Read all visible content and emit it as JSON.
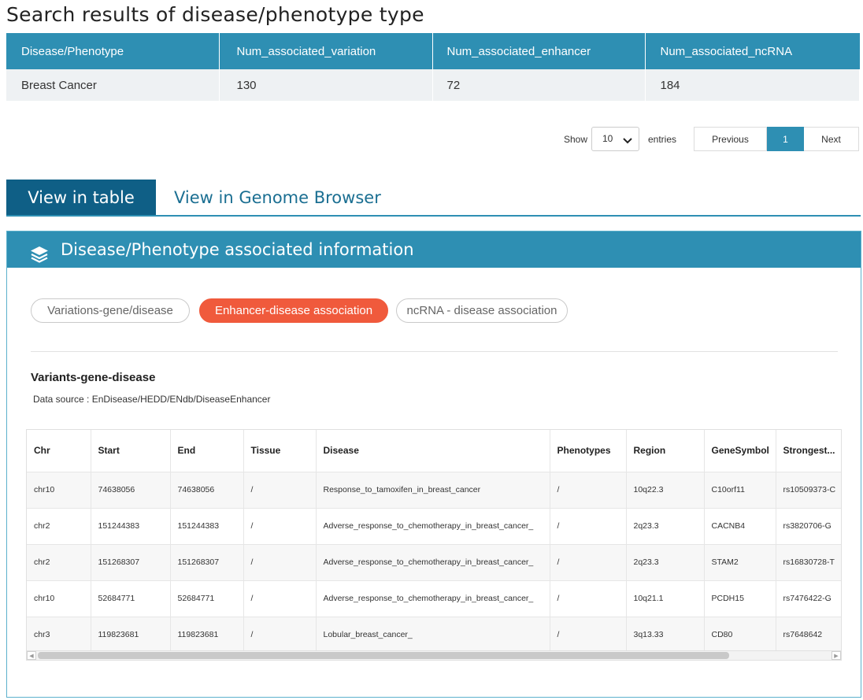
{
  "page": {
    "title": "Search results of disease/phenotype type"
  },
  "summary": {
    "headers": [
      "Disease/Phenotype",
      "Num_associated_variation",
      "Num_associated_enhancer",
      "Num_associated_ncRNA"
    ],
    "row": [
      "Breast Cancer",
      "130",
      "72",
      "184"
    ]
  },
  "paging": {
    "show_label": "Show",
    "entries_value": "10",
    "entries_label": "entries",
    "previous": "Previous",
    "current_page": "1",
    "next": "Next"
  },
  "view_tabs": {
    "table": "View in table",
    "genome": "View in Genome Browser"
  },
  "panel": {
    "title": "Disease/Phenotype associated information",
    "pills": [
      "Variations-gene/disease",
      "Enhancer-disease association",
      "ncRNA - disease association"
    ],
    "active_pill": "Enhancer-disease association",
    "section_title": "Variants-gene-disease",
    "data_source": "Data source : EnDisease/HEDD/ENdb/DiseaseEnhancer"
  },
  "grid": {
    "headers": [
      "Chr",
      "Start",
      "End",
      "Tissue",
      "Disease",
      "Phenotypes",
      "Region",
      "GeneSymbol",
      "Strongest..."
    ],
    "rows": [
      [
        "chr10",
        "74638056",
        "74638056",
        "/",
        "Response_to_tamoxifen_in_breast_cancer",
        "/",
        "10q22.3",
        "C10orf11",
        "rs10509373-C"
      ],
      [
        "chr2",
        "151244383",
        "151244383",
        "/",
        "Adverse_response_to_chemotherapy_in_breast_cancer_",
        "/",
        "2q23.3",
        "CACNB4",
        "rs3820706-G"
      ],
      [
        "chr2",
        "151268307",
        "151268307",
        "/",
        "Adverse_response_to_chemotherapy_in_breast_cancer_",
        "/",
        "2q23.3",
        "STAM2",
        "rs16830728-T"
      ],
      [
        "chr10",
        "52684771",
        "52684771",
        "/",
        "Adverse_response_to_chemotherapy_in_breast_cancer_",
        "/",
        "10q21.1",
        "PCDH15",
        "rs7476422-G"
      ],
      [
        "chr3",
        "119823681",
        "119823681",
        "/",
        "Lobular_breast_cancer_",
        "/",
        "3q13.33",
        "CD80",
        "rs7648642"
      ]
    ]
  },
  "colors": {
    "header_blue": "#2e8fb3",
    "tab_dark": "#0f5f86",
    "pill_active": "#f05a3c"
  }
}
